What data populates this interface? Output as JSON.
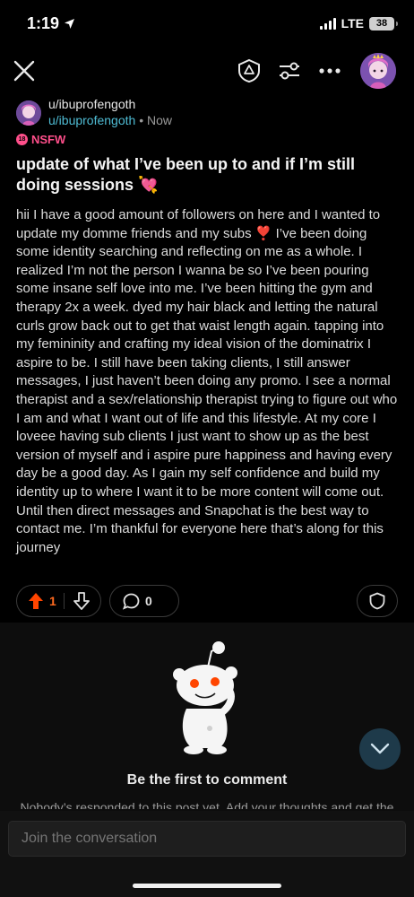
{
  "status_bar": {
    "time": "1:19",
    "network": "LTE",
    "battery": "38"
  },
  "post": {
    "author": "u/ibuprofengoth",
    "subreddit": "u/ibuprofengoth",
    "separator": "•",
    "time_ago": "Now",
    "nsfw_label": "NSFW",
    "nsfw_badge": "18",
    "title": "update of what I’ve been up to and if I’m still doing sessions 💘",
    "body": "hii I have a good amount of followers on here and I wanted to update my domme friends and my subs ❣️ I’ve been doing some identity searching and reflecting on me as a whole. I realized I’m not the person I wanna be so I’ve been pouring some insane self love into me. I’ve been hitting the gym and therapy 2x a week. dyed my hair black and letting the natural curls grow back out to get that waist length again. tapping into my femininity and crafting my ideal vision of the dominatrix I aspire to be. I still have been taking clients, I still answer messages, I just haven’t been doing any promo. I see a normal therapist and a sex/relationship therapist trying to figure out who I am and what I want out of life and this lifestyle. At my core I loveee having sub clients I just want to show up as the best version of myself and i aspire pure happiness and having every day be a good day. As I gain my self confidence and build my identity up to where I want it to be more content will come out. Until then direct messages and Snapchat is the best way to contact me. I’m thankful for everyone here that’s along for this journey",
    "upvotes": "1",
    "comments": "0"
  },
  "comments_section": {
    "empty_title": "Be the first to comment",
    "empty_subtitle": "Nobody’s responded to this post yet. Add your thoughts and get the conversation going.",
    "input_placeholder": "Join the conversation"
  },
  "colors": {
    "upvote_active": "#ff4500",
    "username_link": "#4fbcd4",
    "nsfw": "#ff4f8b"
  },
  "icons": [
    "close-icon",
    "mod-shield-icon",
    "filter-icon",
    "more-icon",
    "upvote-icon",
    "downvote-icon",
    "comment-icon",
    "share-icon",
    "chevron-down-icon"
  ]
}
